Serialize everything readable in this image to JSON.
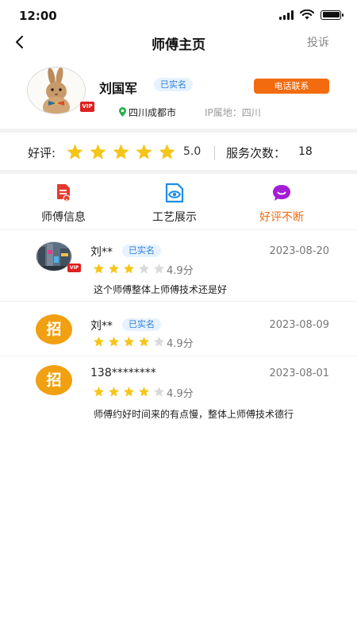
{
  "status_bar": {
    "time": "12:00"
  },
  "nav": {
    "title": "师傅主页",
    "action": "投诉",
    "back_icon": "chevron-left-icon"
  },
  "profile": {
    "name": "刘国军",
    "verified": "已实名",
    "call_button": "电话联系",
    "location": "四川成都市",
    "ip": "IP属地：四川",
    "vip": "VIP"
  },
  "rating": {
    "label": "好评:",
    "stars": 5,
    "score": "5.0",
    "service_label": "服务次数：",
    "service_count": "18"
  },
  "tabs": [
    {
      "label": "师傅信息",
      "icon": "document-icon",
      "active": false
    },
    {
      "label": "工艺展示",
      "icon": "eye-icon",
      "active": false
    },
    {
      "label": "好评不断",
      "icon": "chat-bubble-icon",
      "active": true
    }
  ],
  "reviews": [
    {
      "name": "刘**",
      "verified": "已实名",
      "date": "2023-08-20",
      "stars": 3,
      "score": "4.9分",
      "text": "这个师傅整体上师傅技术还是好",
      "avatar": "photo",
      "vip": "VIP"
    },
    {
      "name": "刘**",
      "verified": "已实名",
      "date": "2023-08-09",
      "stars": 4,
      "score": "4.9分",
      "text": "",
      "avatar": "招"
    },
    {
      "name": "138********",
      "verified": "",
      "date": "2023-08-01",
      "stars": 4,
      "score": "4.9分",
      "text": "师傅约好时间来的有点慢，整体上师傅技术德行",
      "avatar": "招"
    }
  ],
  "colors": {
    "accent": "#f26b0f",
    "star": "#f5c518",
    "star_empty": "#d9d9d9",
    "verified_bg": "#e6f2ff",
    "verified_text": "#2f7fd8"
  }
}
